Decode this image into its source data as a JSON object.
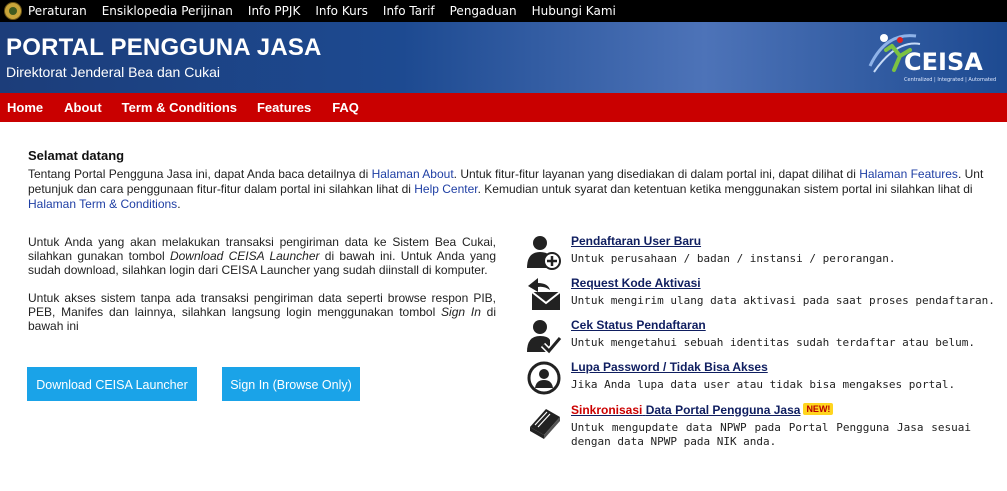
{
  "topnav": {
    "items": [
      "Peraturan",
      "Ensiklopedia Perijinan",
      "Info PPJK",
      "Info Kurs",
      "Info Tarif",
      "Pengaduan",
      "Hubungi Kami"
    ]
  },
  "header": {
    "title": "PORTAL PENGGUNA JASA",
    "subtitle": "Direktorat Jenderal Bea dan Cukai",
    "logo_text": "CEISA",
    "logo_tagline": "Centralized | Integrated | Automated"
  },
  "mainnav": {
    "items": [
      "Home",
      "About",
      "Term & Conditions",
      "Features",
      "FAQ"
    ]
  },
  "welcome": {
    "title": "Selamat datang",
    "p1_a": "Tentang Portal Pengguna Jasa ini, dapat Anda baca detailnya di ",
    "link_about": "Halaman About",
    "p1_b": ". Untuk fitur-fitur layanan yang disediakan di dalam portal ini, dapat dilihat di ",
    "link_features": "Halaman Features",
    "p1_c": ". Unt",
    "p2_a": "petunjuk dan cara penggunaan fitur-fitur dalam portal ini silahkan lihat di ",
    "link_help": "Help Center",
    "p2_b": ". Kemudian untuk syarat dan ketentuan ketika menggunakan sistem portal ini silahkan lihat di",
    "link_terms": "Halaman Term & Conditions",
    "p3_b": "."
  },
  "launcher": {
    "p1_a": "Untuk Anda yang akan melakukan transaksi pengiriman data ke Sistem Bea Cukai, silahkan gunakan tombol ",
    "p1_em": "Download CEISA Launcher",
    "p1_b": " di bawah ini. Untuk Anda yang sudah download, silahkan login dari CEISA Launcher yang sudah diinstall di komputer.",
    "p2_a": "Untuk akses sistem tanpa ada transaksi pengiriman data seperti browse respon PIB, PEB, Manifes dan lainnya, silahkan langsung login menggunakan tombol ",
    "p2_em": "Sign In",
    "p2_b": " di bawah ini",
    "download_button": "Download CEISA Launcher",
    "signin_button": "Sign In (Browse Only)"
  },
  "services": [
    {
      "icon": "user-add-icon",
      "title": "Pendaftaran User Baru",
      "desc": "Untuk perusahaan / badan / instansi / perorangan."
    },
    {
      "icon": "mail-reply-icon",
      "title": "Request Kode Aktivasi",
      "desc": "Untuk mengirim ulang data aktivasi pada saat proses pendaftaran."
    },
    {
      "icon": "user-check-icon",
      "title": "Cek Status Pendaftaran",
      "desc": "Untuk mengetahui sebuah identitas sudah terdaftar atau belum."
    },
    {
      "icon": "user-help-icon",
      "title": "Lupa Password / Tidak Bisa Akses",
      "desc": "Jika Anda lupa data user atau tidak bisa mengakses portal."
    },
    {
      "icon": "book-icon",
      "title_red": "Sinkronisasi",
      "title": "Data Portal Pengguna Jasa",
      "badge": "NEW!",
      "desc": "Untuk mengupdate data NPWP pada Portal Pengguna Jasa sesuai dengan data NPWP pada NIK anda."
    }
  ],
  "colors": {
    "topbar": "#000000",
    "header": "#1d4a91",
    "navbar": "#c90000",
    "button": "#1aa3e8",
    "link": "#1f3fa4",
    "service_title": "#0f1e60"
  }
}
